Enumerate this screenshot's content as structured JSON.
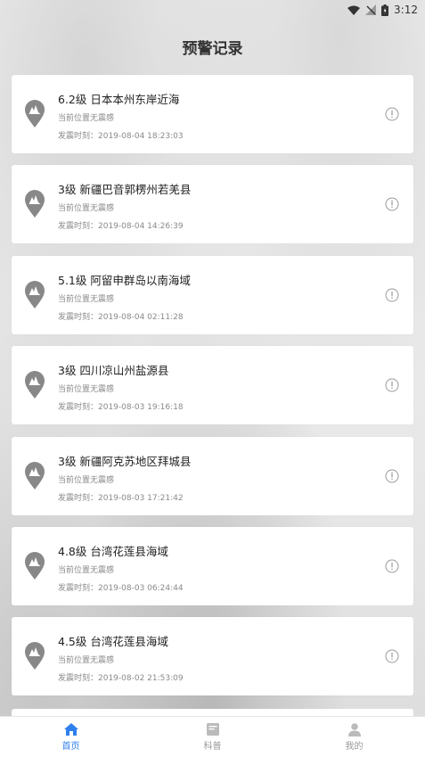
{
  "status_bar": {
    "time": "3:12"
  },
  "page": {
    "title": "预警记录"
  },
  "records": [
    {
      "headline": "6.2级 日本本州东岸近海",
      "status": "当前位置无震感",
      "time": "发震时刻：2019-08-04 18:23:03"
    },
    {
      "headline": "3级 新疆巴音郭楞州若羌县",
      "status": "当前位置无震感",
      "time": "发震时刻：2019-08-04 14:26:39"
    },
    {
      "headline": "5.1级 阿留申群岛以南海域",
      "status": "当前位置无震感",
      "time": "发震时刻：2019-08-04 02:11:28"
    },
    {
      "headline": "3级 四川凉山州盐源县",
      "status": "当前位置无震感",
      "time": "发震时刻：2019-08-03 19:16:18"
    },
    {
      "headline": "3级 新疆阿克苏地区拜城县",
      "status": "当前位置无震感",
      "time": "发震时刻：2019-08-03 17:21:42"
    },
    {
      "headline": "4.8级 台湾花莲县海域",
      "status": "当前位置无震感",
      "time": "发震时刻：2019-08-03 06:24:44"
    },
    {
      "headline": "4.5级 台湾花莲县海域",
      "status": "当前位置无震感",
      "time": "发震时刻：2019-08-02 21:53:09"
    }
  ],
  "nav": {
    "home": "首页",
    "science": "科普",
    "mine": "我的",
    "active": "home",
    "active_color": "#2f80ed",
    "inactive_color": "#999999"
  }
}
